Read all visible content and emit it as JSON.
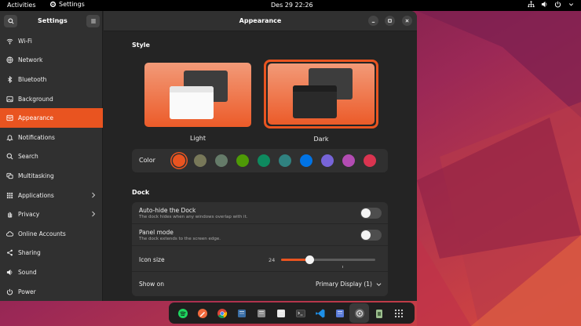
{
  "topbar": {
    "activities": "Activities",
    "app_name": "Settings",
    "clock": "Des 29  22:26"
  },
  "sidebar": {
    "title": "Settings",
    "items": [
      {
        "label": "Wi-Fi",
        "icon": "wifi-icon"
      },
      {
        "label": "Network",
        "icon": "network-icon"
      },
      {
        "label": "Bluetooth",
        "icon": "bluetooth-icon"
      },
      {
        "label": "Background",
        "icon": "background-icon"
      },
      {
        "label": "Appearance",
        "icon": "appearance-icon",
        "active": true
      },
      {
        "label": "Notifications",
        "icon": "bell-icon"
      },
      {
        "label": "Search",
        "icon": "search-icon"
      },
      {
        "label": "Multitasking",
        "icon": "multitasking-icon"
      },
      {
        "label": "Applications",
        "icon": "apps-grid-icon",
        "chevron": true
      },
      {
        "label": "Privacy",
        "icon": "hand-icon",
        "chevron": true
      },
      {
        "label": "Online Accounts",
        "icon": "cloud-icon"
      },
      {
        "label": "Sharing",
        "icon": "share-icon"
      },
      {
        "label": "Sound",
        "icon": "speaker-icon"
      },
      {
        "label": "Power",
        "icon": "power-icon"
      }
    ]
  },
  "header": {
    "title": "Appearance"
  },
  "style": {
    "section_title": "Style",
    "light_label": "Light",
    "dark_label": "Dark",
    "selected": "Dark",
    "color_label": "Color",
    "accent_colors": [
      "#e95420",
      "#787859",
      "#657b69",
      "#4e9a06",
      "#0e8a5f",
      "#308280",
      "#0073e5",
      "#7764d8",
      "#b34cb3",
      "#da3450"
    ],
    "selected_color_index": 0
  },
  "dock_settings": {
    "section_title": "Dock",
    "autohide_title": "Auto-hide the Dock",
    "autohide_sub": "The dock hides when any windows overlap with it.",
    "autohide_on": false,
    "panel_title": "Panel mode",
    "panel_sub": "The dock extends to the screen edge.",
    "panel_on": false,
    "icon_size_label": "Icon size",
    "icon_size_value": "24",
    "icon_size_fraction": 0.3,
    "show_on_label": "Show on",
    "show_on_value": "Primary Display (1)"
  },
  "dock": {
    "apps": [
      {
        "name": "spotify-icon",
        "color": "#1ed760"
      },
      {
        "name": "pen-app-icon",
        "color": "#f26a3d"
      },
      {
        "name": "chrome-icon",
        "color": "#4285f4"
      },
      {
        "name": "image-editor-icon",
        "color": "#3a6ea5"
      },
      {
        "name": "files-icon",
        "color": "#8a8a8a"
      },
      {
        "name": "text-editor-icon",
        "color": "#e8e8e8"
      },
      {
        "name": "terminal-icon",
        "color": "#3c3c3c"
      },
      {
        "name": "vscode-icon",
        "color": "#1e90e8"
      },
      {
        "name": "screen-app-icon",
        "color": "#5a7bd8"
      },
      {
        "name": "settings-app-icon",
        "color": "#9a9a9a"
      },
      {
        "name": "trash-icon",
        "color": "#9dbf8f"
      },
      {
        "name": "show-apps-icon",
        "color": "#dddddd"
      }
    ]
  }
}
